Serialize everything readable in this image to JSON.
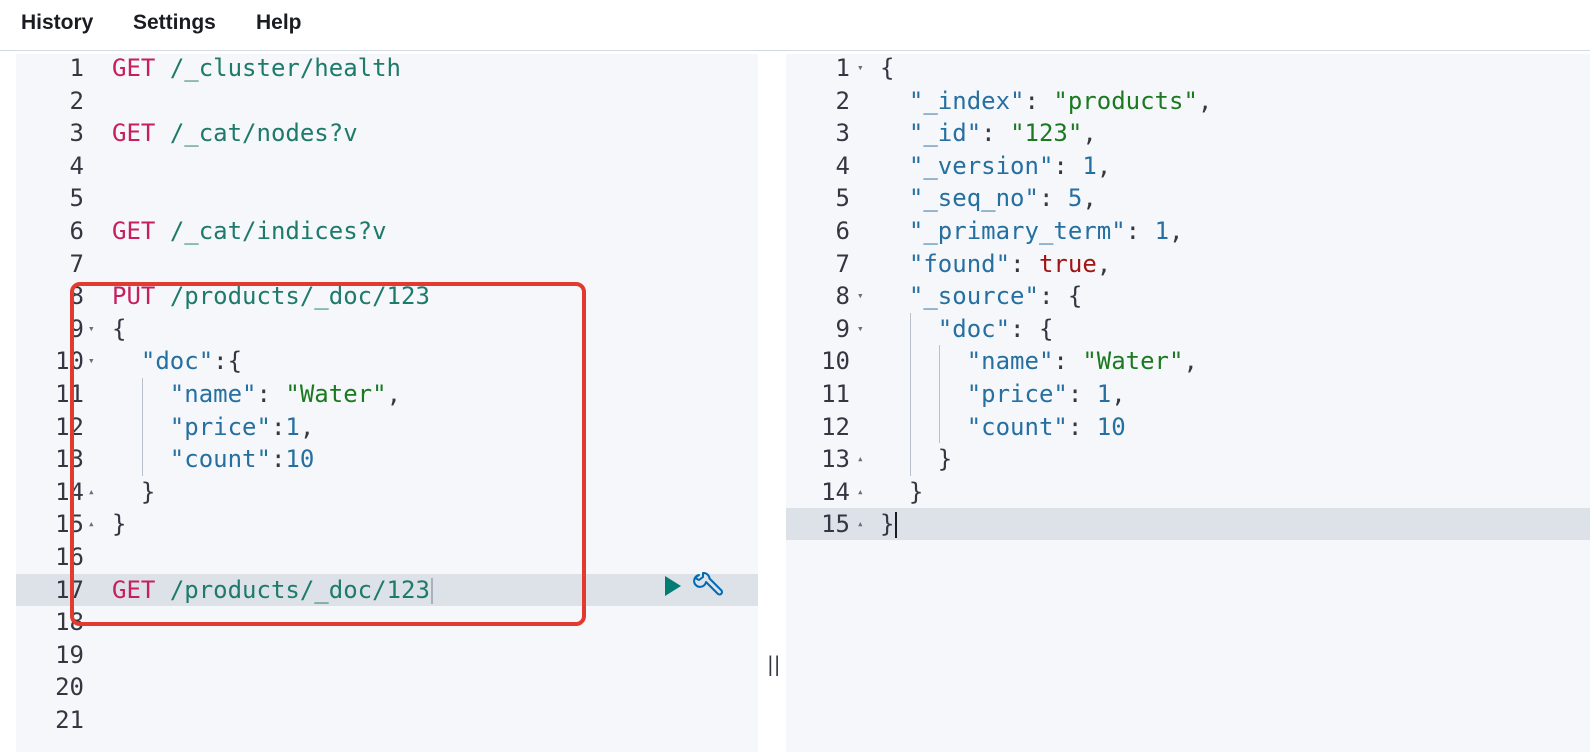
{
  "menu": {
    "history": "History",
    "settings": "Settings",
    "help": "Help"
  },
  "request": {
    "lines": [
      {
        "n": "1",
        "m": "GET",
        "u": "/_cluster/health"
      },
      {
        "n": "2"
      },
      {
        "n": "3",
        "m": "GET",
        "u": "/_cat/nodes?v"
      },
      {
        "n": "4"
      },
      {
        "n": "5"
      },
      {
        "n": "6",
        "m": "GET",
        "u": "/_cat/indices?v"
      },
      {
        "n": "7"
      },
      {
        "n": "8",
        "m": "PUT",
        "u": "/products/_doc/123"
      },
      {
        "n": "9",
        "p": "{"
      },
      {
        "n": "10",
        "ind": "  ",
        "k": "\"doc\"",
        "p": ":{"
      },
      {
        "n": "11",
        "ind": "    ",
        "k": "\"name\"",
        "p": ": ",
        "s": "\"Water\"",
        "p2": ","
      },
      {
        "n": "12",
        "ind": "    ",
        "k": "\"price\"",
        "p": ":",
        "num": "1",
        "p2": ","
      },
      {
        "n": "13",
        "ind": "    ",
        "k": "\"count\"",
        "p": ":",
        "num": "10"
      },
      {
        "n": "14",
        "ind": "  ",
        "p": "}"
      },
      {
        "n": "15",
        "p": "}"
      },
      {
        "n": "16"
      },
      {
        "n": "17",
        "m": "GET",
        "u": "/products/_doc/123"
      },
      {
        "n": "18"
      },
      {
        "n": "19"
      },
      {
        "n": "20"
      },
      {
        "n": "21"
      }
    ]
  },
  "response": {
    "lines": [
      {
        "n": "1",
        "p": "{"
      },
      {
        "n": "2",
        "ind": "  ",
        "k": "\"_index\"",
        "p": ": ",
        "s": "\"products\"",
        "p2": ","
      },
      {
        "n": "3",
        "ind": "  ",
        "k": "\"_id\"",
        "p": ": ",
        "s": "\"123\"",
        "p2": ","
      },
      {
        "n": "4",
        "ind": "  ",
        "k": "\"_version\"",
        "p": ": ",
        "num": "1",
        "p2": ","
      },
      {
        "n": "5",
        "ind": "  ",
        "k": "\"_seq_no\"",
        "p": ": ",
        "num": "5",
        "p2": ","
      },
      {
        "n": "6",
        "ind": "  ",
        "k": "\"_primary_term\"",
        "p": ": ",
        "num": "1",
        "p2": ","
      },
      {
        "n": "7",
        "ind": "  ",
        "k": "\"found\"",
        "p": ": ",
        "b": "true",
        "p2": ","
      },
      {
        "n": "8",
        "ind": "  ",
        "k": "\"_source\"",
        "p": ": {"
      },
      {
        "n": "9",
        "ind": "    ",
        "k": "\"doc\"",
        "p": ": {"
      },
      {
        "n": "10",
        "ind": "      ",
        "k": "\"name\"",
        "p": ": ",
        "s": "\"Water\"",
        "p2": ","
      },
      {
        "n": "11",
        "ind": "      ",
        "k": "\"price\"",
        "p": ": ",
        "num": "1",
        "p2": ","
      },
      {
        "n": "12",
        "ind": "      ",
        "k": "\"count\"",
        "p": ": ",
        "num": "10"
      },
      {
        "n": "13",
        "ind": "    ",
        "p": "}"
      },
      {
        "n": "14",
        "ind": "  ",
        "p": "}"
      },
      {
        "n": "15",
        "p": "}"
      }
    ]
  },
  "colors": {
    "method": "#c61e5f",
    "url": "#1e7a6b",
    "key": "#266fa1",
    "string": "#1b7a20",
    "number": "#266fa1",
    "boolean": "#a31515",
    "highlight": "#e23a2e",
    "run_button": "#017d73",
    "wrench": "#006bb4"
  },
  "icons": {
    "run": "play-icon",
    "settings": "wrench-icon",
    "splitter": "drag-handle-icon"
  },
  "splitter_glyph": "||"
}
